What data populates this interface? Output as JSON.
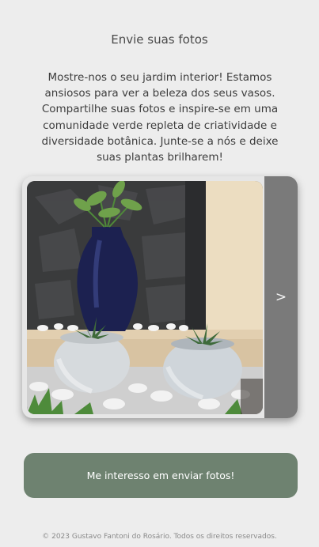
{
  "section": {
    "title": "Envie suas fotos",
    "intro": "Mostre-nos o seu jardim interior! Estamos ansiosos para ver a beleza dos seus vasos. Compartilhe suas fotos e inspire-se em uma comunidade verde repleta de criatividade e diversidade botânica. Junte-se a nós e deixe suas plantas brilharem!"
  },
  "carousel": {
    "next_label": ">"
  },
  "cta": {
    "label": "Me interesso em enviar fotos!"
  },
  "footer": {
    "text": "© 2023 Gustavo Fantoni do Rosário. Todos os direitos reservados."
  },
  "colors": {
    "background": "#ededed",
    "cta": "#6e8270",
    "next_button": "#7a7a7a"
  }
}
